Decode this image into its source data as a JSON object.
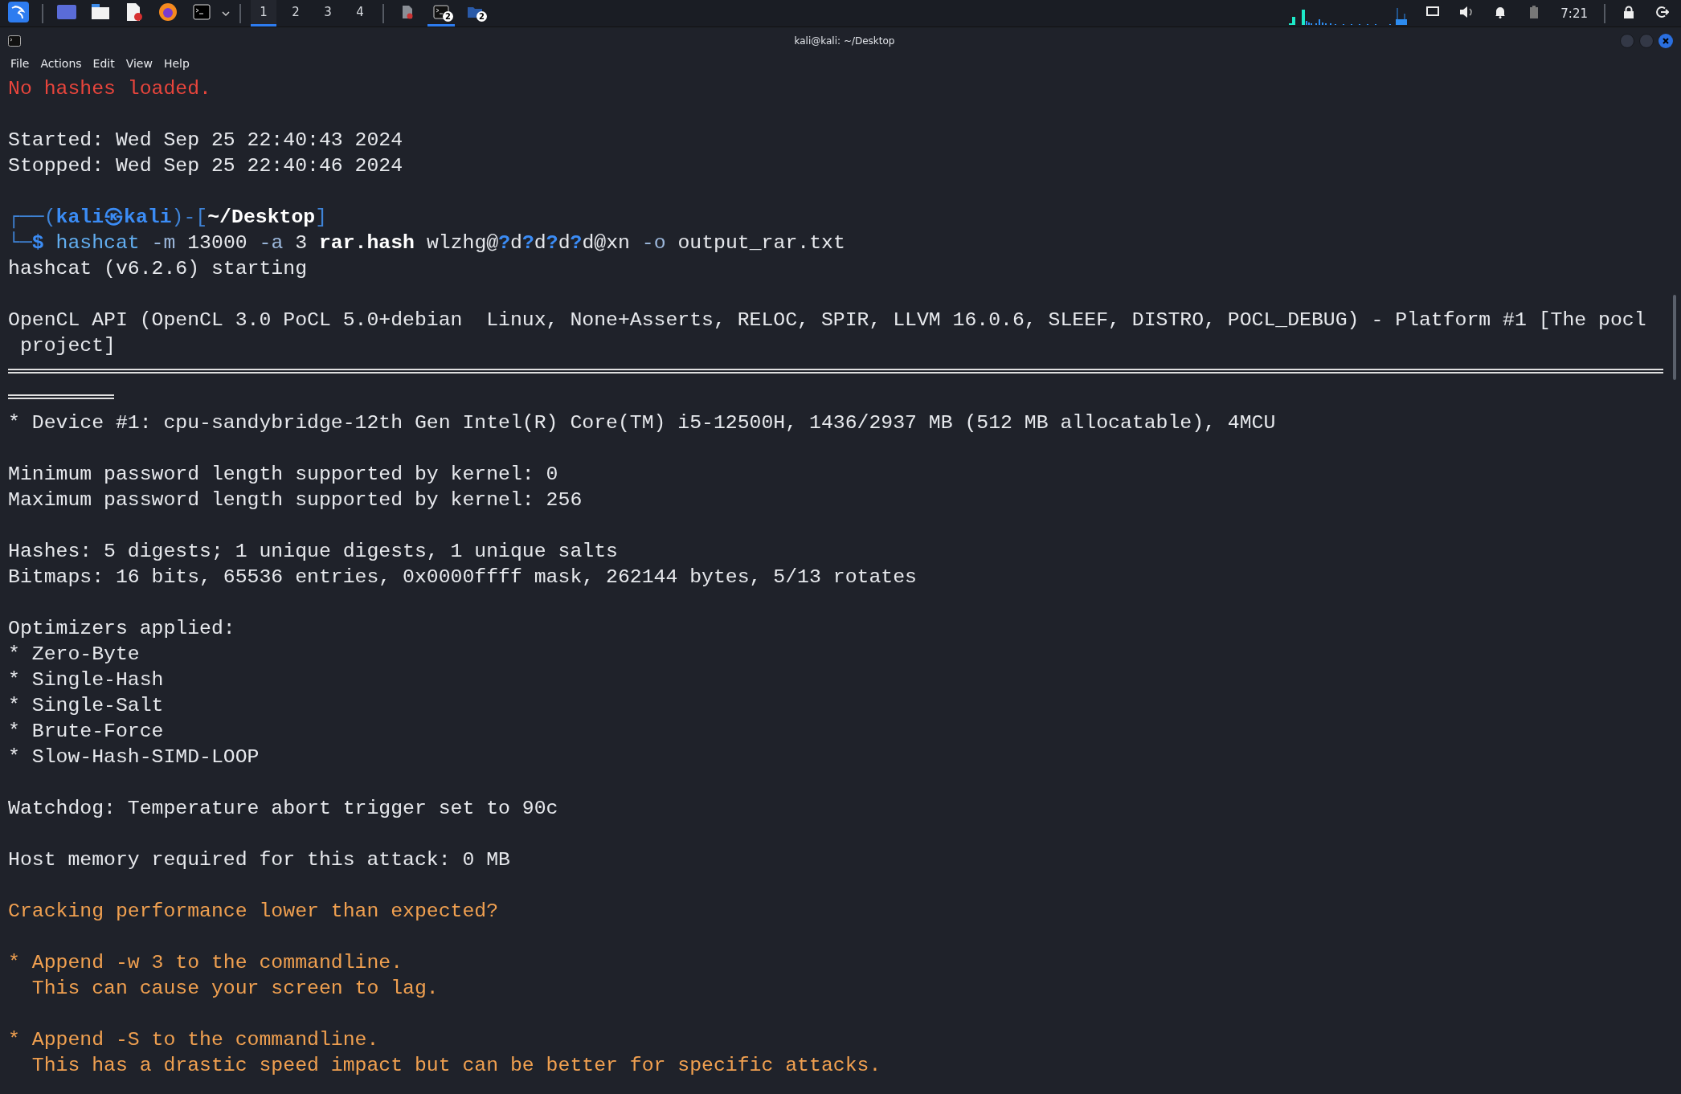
{
  "taskbar": {
    "workspaces": [
      {
        "label": "1",
        "selected": true
      },
      {
        "label": "2",
        "selected": false
      },
      {
        "label": "3",
        "selected": false
      },
      {
        "label": "4",
        "selected": false
      }
    ],
    "windows": [
      {
        "kind": "document",
        "selected": false
      },
      {
        "kind": "terminal",
        "badge": "2",
        "selected": true
      },
      {
        "kind": "folder",
        "badge": "2",
        "selected": false
      }
    ],
    "clock": "7:21"
  },
  "window": {
    "title": "kali@kali: ~/Desktop"
  },
  "menu": [
    "File",
    "Actions",
    "Edit",
    "View",
    "Help"
  ],
  "lines": [
    {
      "kind": "text",
      "segments": [
        {
          "kind": "error",
          "text": "No hashes loaded."
        }
      ]
    },
    {
      "kind": "blank"
    },
    {
      "kind": "text",
      "segments": [
        {
          "kind": "plain",
          "text": "Started: Wed Sep 25 22:40:43 2024"
        }
      ]
    },
    {
      "kind": "text",
      "segments": [
        {
          "kind": "plain",
          "text": "Stopped: Wed Sep 25 22:40:46 2024"
        }
      ]
    },
    {
      "kind": "blank"
    },
    {
      "kind": "text",
      "segments": [
        {
          "kind": "frame",
          "text": "┌──("
        },
        {
          "kind": "user",
          "text": "kali㉿kali"
        },
        {
          "kind": "frame",
          "text": ")-["
        },
        {
          "kind": "bold",
          "text": "~/Desktop"
        },
        {
          "kind": "frame",
          "text": "]"
        }
      ]
    },
    {
      "kind": "text",
      "segments": [
        {
          "kind": "frame",
          "text": "└─"
        },
        {
          "kind": "user",
          "text": "$ "
        },
        {
          "kind": "command",
          "text": "hashcat"
        },
        {
          "kind": "option",
          "text": " -m"
        },
        {
          "kind": "plain",
          "text": " 13000 "
        },
        {
          "kind": "option",
          "text": "-a"
        },
        {
          "kind": "plain",
          "text": " 3 "
        },
        {
          "kind": "bold",
          "text": "rar.hash"
        },
        {
          "kind": "plain",
          "text": " wlzhg@"
        },
        {
          "kind": "user",
          "text": "?"
        },
        {
          "kind": "plain",
          "text": "d"
        },
        {
          "kind": "user",
          "text": "?"
        },
        {
          "kind": "plain",
          "text": "d"
        },
        {
          "kind": "user",
          "text": "?"
        },
        {
          "kind": "plain",
          "text": "d"
        },
        {
          "kind": "user",
          "text": "?"
        },
        {
          "kind": "plain",
          "text": "d@xn "
        },
        {
          "kind": "option",
          "text": "-o"
        },
        {
          "kind": "plain",
          "text": " output_rar.txt"
        }
      ]
    },
    {
      "kind": "text",
      "segments": [
        {
          "kind": "plain",
          "text": "hashcat (v6.2.6) starting"
        }
      ]
    },
    {
      "kind": "blank"
    },
    {
      "kind": "text",
      "segments": [
        {
          "kind": "plain",
          "text": "OpenCL API (OpenCL 3.0 PoCL 5.0+debian  Linux, None+Asserts, RELOC, SPIR, LLVM 16.0.6, SLEEF, DISTRO, POCL_DEBUG) - Platform #1 [The pocl"
        }
      ]
    },
    {
      "kind": "text",
      "segments": [
        {
          "kind": "plain",
          "text": " project]"
        }
      ]
    },
    {
      "kind": "rule"
    },
    {
      "kind": "short-rule"
    },
    {
      "kind": "text",
      "segments": [
        {
          "kind": "plain",
          "text": "* Device #1: cpu-sandybridge-12th Gen Intel(R) Core(TM) i5-12500H, 1436/2937 MB (512 MB allocatable), 4MCU"
        }
      ]
    },
    {
      "kind": "blank"
    },
    {
      "kind": "text",
      "segments": [
        {
          "kind": "plain",
          "text": "Minimum password length supported by kernel: 0"
        }
      ]
    },
    {
      "kind": "text",
      "segments": [
        {
          "kind": "plain",
          "text": "Maximum password length supported by kernel: 256"
        }
      ]
    },
    {
      "kind": "blank"
    },
    {
      "kind": "text",
      "segments": [
        {
          "kind": "plain",
          "text": "Hashes: 5 digests; 1 unique digests, 1 unique salts"
        }
      ]
    },
    {
      "kind": "text",
      "segments": [
        {
          "kind": "plain",
          "text": "Bitmaps: 16 bits, 65536 entries, 0x0000ffff mask, 262144 bytes, 5/13 rotates"
        }
      ]
    },
    {
      "kind": "blank"
    },
    {
      "kind": "text",
      "segments": [
        {
          "kind": "plain",
          "text": "Optimizers applied:"
        }
      ]
    },
    {
      "kind": "text",
      "segments": [
        {
          "kind": "plain",
          "text": "* Zero-Byte"
        }
      ]
    },
    {
      "kind": "text",
      "segments": [
        {
          "kind": "plain",
          "text": "* Single-Hash"
        }
      ]
    },
    {
      "kind": "text",
      "segments": [
        {
          "kind": "plain",
          "text": "* Single-Salt"
        }
      ]
    },
    {
      "kind": "text",
      "segments": [
        {
          "kind": "plain",
          "text": "* Brute-Force"
        }
      ]
    },
    {
      "kind": "text",
      "segments": [
        {
          "kind": "plain",
          "text": "* Slow-Hash-SIMD-LOOP"
        }
      ]
    },
    {
      "kind": "blank"
    },
    {
      "kind": "text",
      "segments": [
        {
          "kind": "plain",
          "text": "Watchdog: Temperature abort trigger set to 90c"
        }
      ]
    },
    {
      "kind": "blank"
    },
    {
      "kind": "text",
      "segments": [
        {
          "kind": "plain",
          "text": "Host memory required for this attack: 0 MB"
        }
      ]
    },
    {
      "kind": "blank"
    },
    {
      "kind": "text",
      "segments": [
        {
          "kind": "warn",
          "text": "Cracking performance lower than expected?"
        }
      ]
    },
    {
      "kind": "blank"
    },
    {
      "kind": "text",
      "segments": [
        {
          "kind": "warn",
          "text": "* Append -w 3 to the commandline."
        }
      ]
    },
    {
      "kind": "text",
      "segments": [
        {
          "kind": "warn",
          "text": "  This can cause your screen to lag."
        }
      ]
    },
    {
      "kind": "blank"
    },
    {
      "kind": "text",
      "segments": [
        {
          "kind": "warn",
          "text": "* Append -S to the commandline."
        }
      ]
    },
    {
      "kind": "text",
      "segments": [
        {
          "kind": "warn",
          "text": "  This has a drastic speed impact but can be better for specific attacks."
        }
      ]
    }
  ]
}
